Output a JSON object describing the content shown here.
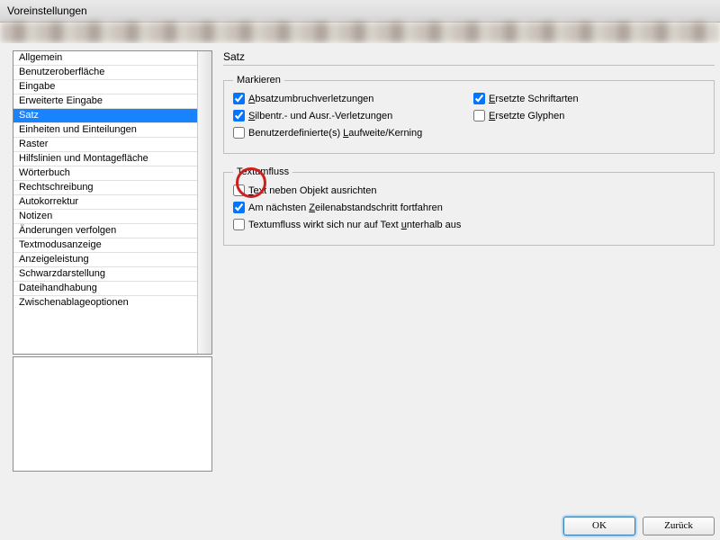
{
  "window": {
    "title": "Voreinstellungen"
  },
  "sidebar": {
    "items": [
      "Allgemein",
      "Benutzeroberfläche",
      "Eingabe",
      "Erweiterte Eingabe",
      "Satz",
      "Einheiten und Einteilungen",
      "Raster",
      "Hilfslinien und Montagefläche",
      "Wörterbuch",
      "Rechtschreibung",
      "Autokorrektur",
      "Notizen",
      "Änderungen verfolgen",
      "Textmodusanzeige",
      "Anzeigeleistung",
      "Schwarzdarstellung",
      "Dateihandhabung",
      "Zwischenablageoptionen"
    ],
    "selected_index": 4
  },
  "panel": {
    "title": "Satz",
    "group_mark": {
      "legend": "Markieren",
      "opts": [
        {
          "label_pre": "",
          "acc": "A",
          "label_post": "bsatzumbruchverletzungen",
          "checked": true
        },
        {
          "label_pre": "",
          "acc": "E",
          "label_post": "rsetzte Schriftarten",
          "checked": true
        },
        {
          "label_pre": "",
          "acc": "S",
          "label_post": "ilbentr.- und Ausr.-Verletzungen",
          "checked": true
        },
        {
          "label_pre": "",
          "acc": "E",
          "label_post": "rsetzte Glyphen",
          "checked": false
        },
        {
          "label_pre": "Benutzerdefinierte(s) ",
          "acc": "L",
          "label_post": "aufweite/Kerning",
          "checked": false
        }
      ]
    },
    "group_flow": {
      "legend": "Textumfluss",
      "opts": [
        {
          "label_pre": "",
          "acc": "T",
          "label_post": "ext neben Objekt ausrichten",
          "checked": false
        },
        {
          "label_pre": "Am nächsten ",
          "acc": "Z",
          "label_post": "eilenabstandschritt fortfahren",
          "checked": true
        },
        {
          "label_pre": "Textumfluss wirkt sich nur auf Text ",
          "acc": "u",
          "label_post": "nterhalb aus",
          "checked": false
        }
      ]
    }
  },
  "footer": {
    "ok": "OK",
    "back": "Zurück"
  }
}
